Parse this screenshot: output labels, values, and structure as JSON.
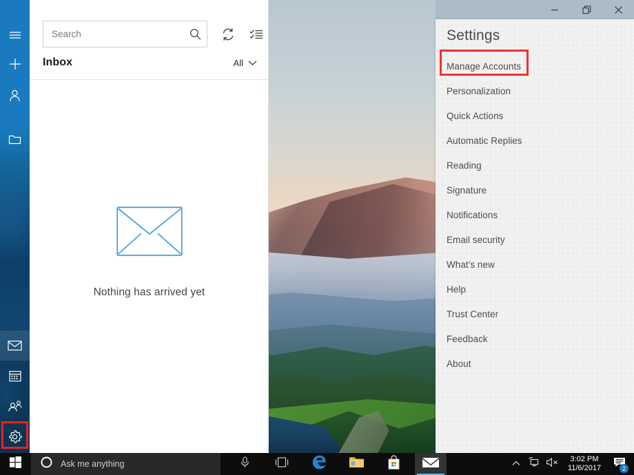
{
  "mail_app": {
    "sidebar": {
      "items": [
        {
          "name": "hamburger-menu",
          "icon": "hamburger-icon",
          "label": "Menu"
        },
        {
          "name": "new-mail",
          "icon": "plus-icon",
          "label": "New mail"
        },
        {
          "name": "accounts",
          "icon": "person-icon",
          "label": "Accounts"
        },
        {
          "name": "folders",
          "icon": "folder-icon",
          "label": "Folders"
        }
      ],
      "bottom_items": [
        {
          "name": "mail",
          "icon": "envelope-icon",
          "label": "Mail",
          "active": true
        },
        {
          "name": "calendar",
          "icon": "calendar-icon",
          "label": "Calendar",
          "active": false
        },
        {
          "name": "people",
          "icon": "people-icon",
          "label": "People",
          "active": false
        },
        {
          "name": "settings",
          "icon": "gear-icon",
          "label": "Settings",
          "active": false,
          "highlighted": true
        }
      ]
    },
    "search": {
      "value": "",
      "placeholder": "Search",
      "icon": "search-icon"
    },
    "toolbar": {
      "sync_icon": "sync-icon",
      "sync_label": "Sync this view",
      "select_icon": "selection-mode-icon",
      "select_label": "Enter selection mode"
    },
    "folder_header": {
      "title": "Inbox",
      "filter_label": "All",
      "filter_icon": "chevron-down-icon"
    },
    "empty_state": {
      "icon": "envelope-outline-icon",
      "message": "Nothing has arrived yet"
    }
  },
  "settings_flyout": {
    "title": "Settings",
    "window_controls": [
      {
        "name": "minimize",
        "glyph": "—",
        "label": "Minimize"
      },
      {
        "name": "maximize",
        "glyph": "❐",
        "label": "Restore"
      },
      {
        "name": "close",
        "glyph": "✕",
        "label": "Close"
      }
    ],
    "items": [
      {
        "label": "Manage Accounts",
        "highlighted": true
      },
      {
        "label": "Personalization",
        "highlighted": false
      },
      {
        "label": "Quick Actions",
        "highlighted": false
      },
      {
        "label": "Automatic Replies",
        "highlighted": false
      },
      {
        "label": "Reading",
        "highlighted": false
      },
      {
        "label": "Signature",
        "highlighted": false
      },
      {
        "label": "Notifications",
        "highlighted": false
      },
      {
        "label": "Email security",
        "highlighted": false
      },
      {
        "label": "What's new",
        "highlighted": false
      },
      {
        "label": "Help",
        "highlighted": false
      },
      {
        "label": "Trust Center",
        "highlighted": false
      },
      {
        "label": "Feedback",
        "highlighted": false
      },
      {
        "label": "About",
        "highlighted": false
      }
    ],
    "highlight_color": "#f03030"
  },
  "taskbar": {
    "start_label": "Start",
    "cortana": {
      "icon": "cortana-circle-icon",
      "placeholder": "Ask me anything"
    },
    "apps": [
      {
        "name": "task-view",
        "icon": "task-view-icon",
        "label": "Task View",
        "active": false
      },
      {
        "name": "edge",
        "icon": "edge-icon",
        "label": "Microsoft Edge",
        "active": false
      },
      {
        "name": "file-explorer",
        "icon": "folder-icon",
        "label": "File Explorer",
        "active": false
      },
      {
        "name": "store",
        "icon": "store-bag-icon",
        "label": "Microsoft Store",
        "active": false
      },
      {
        "name": "mail",
        "icon": "envelope-icon",
        "label": "Mail",
        "active": true
      }
    ],
    "tray": {
      "chevron_icon": "chevron-up-icon",
      "network_icon": "network-icon",
      "volume_icon": "volume-muted-icon",
      "time": "3:02 PM",
      "date": "11/6/2017",
      "action_center_icon": "action-center-icon",
      "notification_count": "2"
    }
  },
  "colors": {
    "accent_blue": "#1a7ac0",
    "highlight_red": "#f03030",
    "panel_gray": "#f0f0f0",
    "taskbar_black": "#0d0d0d"
  }
}
